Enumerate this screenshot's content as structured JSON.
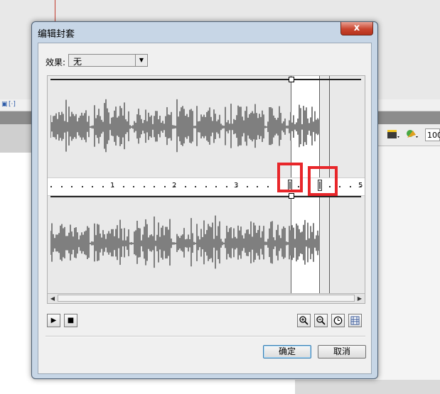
{
  "dialog": {
    "title": "编辑封套",
    "close_label": "x"
  },
  "effect": {
    "label": "效果:",
    "selected": "无"
  },
  "ruler": {
    "labels": [
      "1",
      "2",
      "3",
      "5"
    ]
  },
  "buttons": {
    "ok": "确定",
    "cancel": "取消"
  },
  "background": {
    "zoom_value": "100"
  },
  "colors": {
    "highlight_box": "#e8262a",
    "waveform": "#7f7f7f",
    "dialog_frame": "#c7d6e6",
    "close_button": "#c9452f"
  },
  "icons": [
    "play-icon",
    "stop-icon",
    "zoom-in-icon",
    "zoom-out-icon",
    "clock-icon",
    "frames-icon"
  ]
}
